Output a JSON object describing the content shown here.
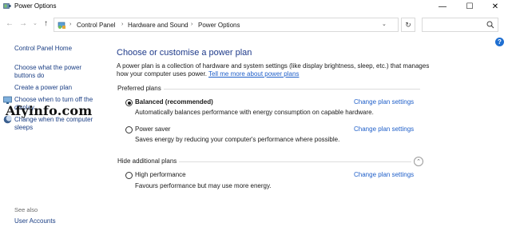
{
  "window": {
    "title": "Power Options",
    "minimize_glyph": "—",
    "maximize_glyph": "☐",
    "close_glyph": "✕"
  },
  "nav": {
    "back_glyph": "←",
    "forward_glyph": "→",
    "recent_glyph": "⌄",
    "up_glyph": "↑",
    "refresh_glyph": "↻",
    "dropdown_glyph": "⌄"
  },
  "breadcrumb": {
    "separator": "›",
    "items": [
      "Control Panel",
      "Hardware and Sound",
      "Power Options"
    ]
  },
  "search": {
    "placeholder": ""
  },
  "help": {
    "glyph": "?"
  },
  "sidebar": {
    "home": "Control Panel Home",
    "links": [
      "Choose what the power buttons do",
      "Create a power plan",
      "Choose when to turn off the display",
      "Change when the computer sleeps"
    ],
    "see_also_label": "See also",
    "see_also_links": [
      "User Accounts"
    ]
  },
  "watermark": "Afyinfo.com",
  "main": {
    "title": "Choose or customise a power plan",
    "intro": "A power plan is a collection of hardware and system settings (like display brightness, sleep, etc.) that manages how your computer uses power.",
    "intro_link": "Tell me more about power plans",
    "preferred_label": "Preferred plans",
    "hide_label": "Hide additional plans",
    "collapse_glyph": "⌃",
    "change_label": "Change plan settings",
    "plans": [
      {
        "name": "Balanced (recommended)",
        "desc": "Automatically balances performance with energy consumption on capable hardware.",
        "selected": true
      },
      {
        "name": "Power saver",
        "desc": "Saves energy by reducing your computer's performance where possible.",
        "selected": false
      },
      {
        "name": "High performance",
        "desc": "Favours performance but may use more energy.",
        "selected": false
      }
    ]
  },
  "colors": {
    "link": "#1f5fc9",
    "title": "#1e3a8a",
    "sidebar_link": "#1a3e84",
    "help": "#1f6fd1"
  }
}
